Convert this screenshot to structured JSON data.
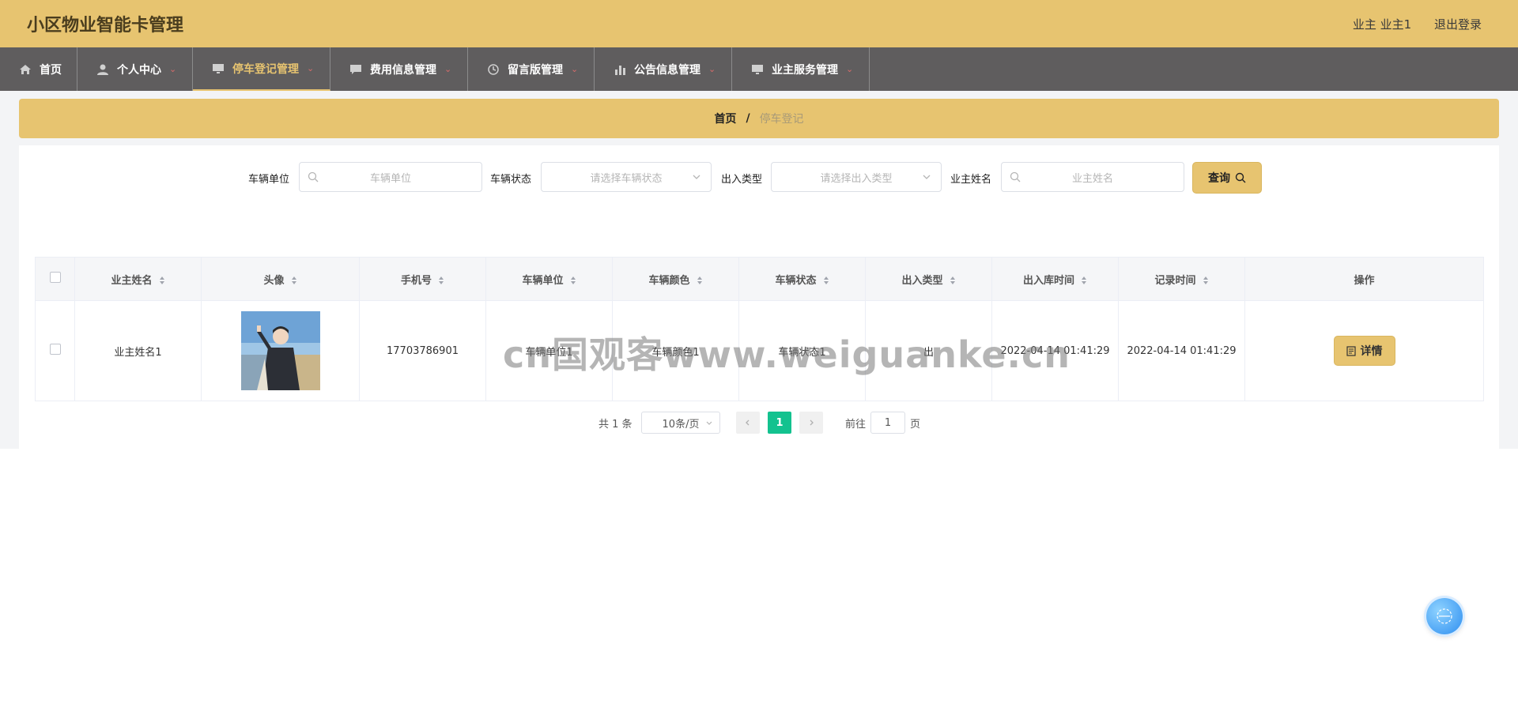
{
  "app": {
    "title": "小区物业智能卡管理"
  },
  "user": {
    "role_name": "业主 业主1",
    "logout": "退出登录"
  },
  "nav": {
    "items": [
      {
        "label": "首页",
        "icon": "home-icon",
        "has_caret": false
      },
      {
        "label": "个人中心",
        "icon": "user-icon",
        "has_caret": true
      },
      {
        "label": "停车登记管理",
        "icon": "monitor-icon",
        "has_caret": true,
        "active": true
      },
      {
        "label": "费用信息管理",
        "icon": "message-icon",
        "has_caret": true
      },
      {
        "label": "留言版管理",
        "icon": "clock-icon",
        "has_caret": true
      },
      {
        "label": "公告信息管理",
        "icon": "chart-icon",
        "has_caret": true
      },
      {
        "label": "业主服务管理",
        "icon": "monitor-icon",
        "has_caret": true
      }
    ]
  },
  "breadcrumb": {
    "home": "首页",
    "separator": "/",
    "current": "停车登记"
  },
  "search": {
    "vehicle_unit": {
      "label": "车辆单位",
      "placeholder": "车辆单位"
    },
    "vehicle_status": {
      "label": "车辆状态",
      "placeholder": "请选择车辆状态"
    },
    "entry_type": {
      "label": "出入类型",
      "placeholder": "请选择出入类型"
    },
    "owner_name": {
      "label": "业主姓名",
      "placeholder": "业主姓名"
    },
    "query_label": "查询"
  },
  "table": {
    "columns": [
      "业主姓名",
      "头像",
      "手机号",
      "车辆单位",
      "车辆颜色",
      "车辆状态",
      "出入类型",
      "出入库时间",
      "记录时间",
      "操作"
    ],
    "rows": [
      {
        "owner_name": "业主姓名1",
        "phone": "17703786901",
        "vehicle_unit": "车辆单位1",
        "vehicle_color": "车辆颜色1",
        "vehicle_status": "车辆状态1",
        "entry_type": "出",
        "entry_time": "2022-04-14 01:41:29",
        "record_time": "2022-04-14 01:41:29",
        "action_label": "详情"
      }
    ]
  },
  "pagination": {
    "total_text": "共 1 条",
    "page_size": "10条/页",
    "current_page": "1",
    "goto_label": "前往",
    "goto_value": "1",
    "page_unit": "页"
  },
  "watermark": "cn国观客www.weiguanke.cn",
  "colors": {
    "accent": "#e7c470",
    "nav_bg": "#5f5d5e",
    "pager_active": "#13c28f"
  }
}
